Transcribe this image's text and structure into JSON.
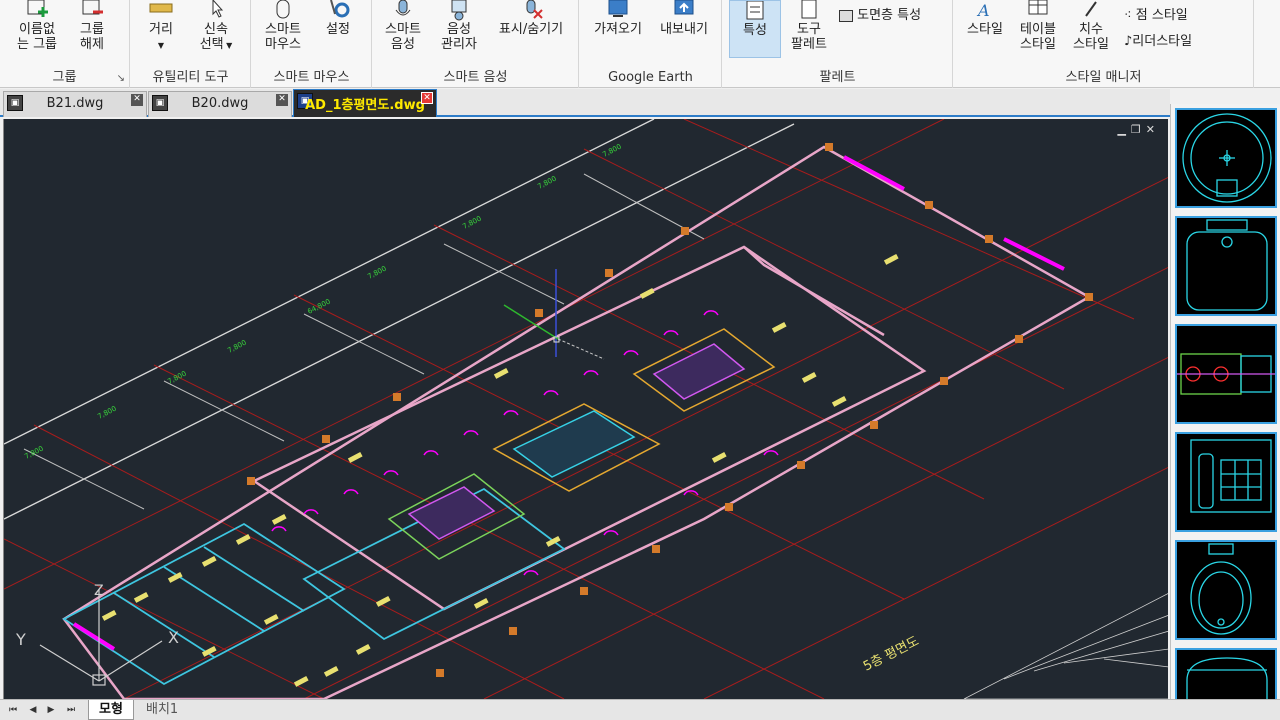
{
  "ribbon": {
    "groups": {
      "group": "그룹",
      "utility": "유틸리티 도구",
      "smart_mouse": "스마트 마우스",
      "smart_voice": "스마트 음성",
      "google_earth": "Google Earth",
      "palette": "팔레트",
      "style_manager": "스타일 매니저"
    },
    "buttons": {
      "unnamed_group_l1": "이름없",
      "unnamed_group_l2": "는 그룹",
      "ungroup_l1": "그룹",
      "ungroup_l2": "해제",
      "distance": "거리",
      "quick_select_l1": "신속",
      "quick_select_l2": "선택",
      "smart_mouse_l1": "스마트",
      "smart_mouse_l2": "마우스",
      "settings": "설정",
      "smart_voice_l1": "스마트",
      "smart_voice_l2": "음성",
      "voice_manager_l1": "음성",
      "voice_manager_l2": "관리자",
      "show_hide": "표시/숨기기",
      "import": "가져오기",
      "export": "내보내기",
      "properties": "특성",
      "tool_palette_l1": "도구",
      "tool_palette_l2": "팔레트",
      "sheet_properties": "도면층 특성",
      "style": "스타일",
      "table_style_l1": "테이블",
      "table_style_l2": "스타일",
      "dim_style_l1": "치수",
      "dim_style_l2": "스타일",
      "point_style": "점 스타일",
      "leader_style": "리더스타일"
    }
  },
  "tabs": [
    {
      "label": "B21.dwg",
      "active": false
    },
    {
      "label": "B20.dwg",
      "active": false
    },
    {
      "label": "AD_1층평면도.dwg",
      "active": true
    }
  ],
  "drawing": {
    "plan_title": "5층 평면도",
    "dim_labels": [
      "7,800",
      "7,800",
      "7,800",
      "7,800",
      "64,800",
      "7,800",
      "7,800",
      "7,800",
      "7,800"
    ],
    "axis_x": "X",
    "axis_y": "Y",
    "axis_z": "Z"
  },
  "bottom": {
    "tabs": [
      {
        "label": "모형",
        "active": true
      },
      {
        "label": "배치1",
        "active": false
      }
    ]
  },
  "colors": {
    "canvas_bg": "#212830",
    "wall": "#e8a6c8",
    "door": "#ff00ff",
    "grid": "#c81e1e",
    "accent": "#2d7cc8"
  }
}
